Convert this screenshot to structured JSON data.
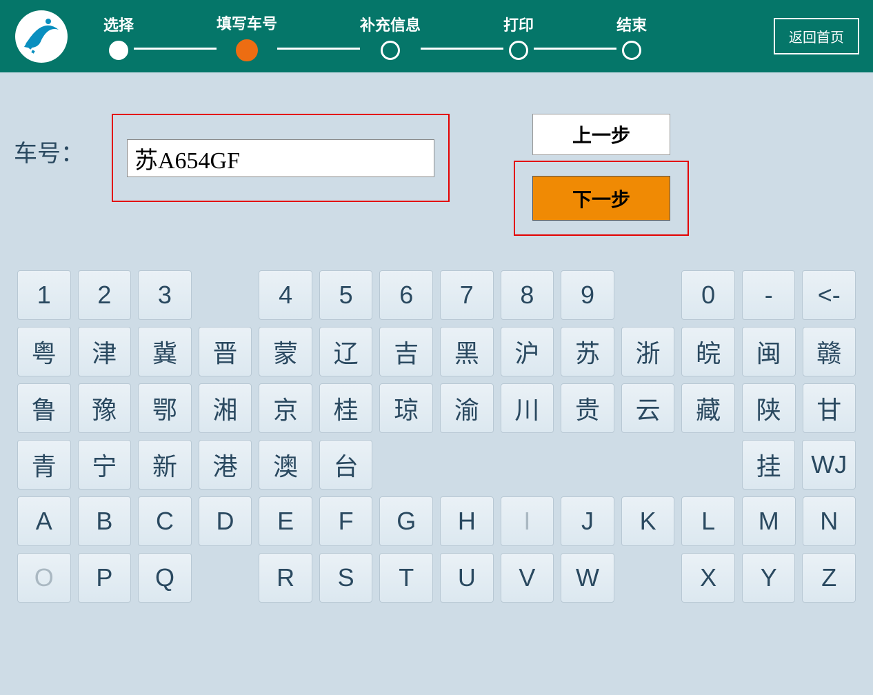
{
  "header": {
    "steps": [
      "选择",
      "填写车号",
      "补充信息",
      "打印",
      "结束"
    ],
    "active_step_index": 1,
    "home_label": "返回首页"
  },
  "form": {
    "field_label": "车号：",
    "plate_value": "苏A654GF",
    "prev_label": "上一步",
    "next_label": "下一步"
  },
  "keyboard": {
    "row1": [
      "1",
      "2",
      "3",
      "",
      "4",
      "5",
      "6",
      "7",
      "8",
      "9",
      "",
      "0",
      "-",
      "<-"
    ],
    "row2": [
      "粤",
      "津",
      "冀",
      "晋",
      "蒙",
      "辽",
      "吉",
      "黑",
      "沪",
      "苏",
      "浙",
      "皖",
      "闽",
      "赣"
    ],
    "row3": [
      "鲁",
      "豫",
      "鄂",
      "湘",
      "京",
      "桂",
      "琼",
      "渝",
      "川",
      "贵",
      "云",
      "藏",
      "陕",
      "甘"
    ],
    "row4": [
      "青",
      "宁",
      "新",
      "港",
      "澳",
      "台",
      "",
      "",
      "",
      "",
      "",
      "",
      "挂",
      "WJ"
    ],
    "row5": [
      "A",
      "B",
      "C",
      "D",
      "E",
      "F",
      "G",
      "H",
      "I",
      "J",
      "K",
      "L",
      "M",
      "N"
    ],
    "row6": [
      "O",
      "P",
      "Q",
      "",
      "R",
      "S",
      "T",
      "U",
      "V",
      "W",
      "",
      "X",
      "Y",
      "Z"
    ],
    "dim_keys": [
      "I",
      "O"
    ]
  }
}
